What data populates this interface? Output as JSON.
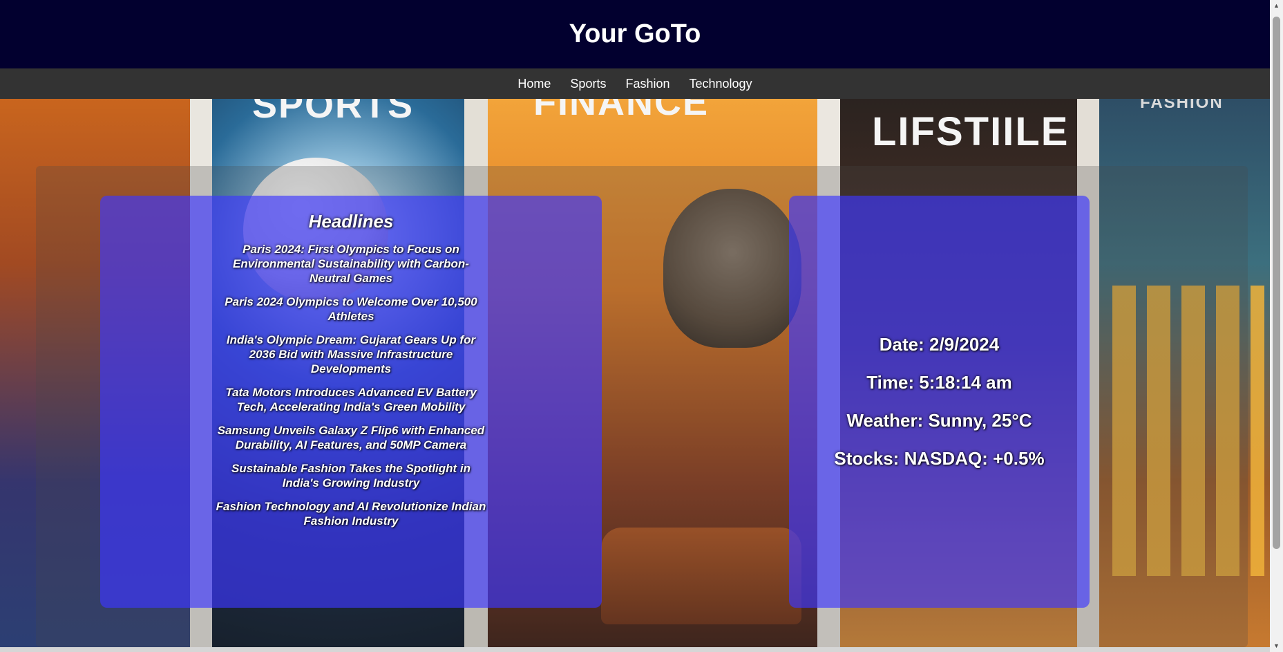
{
  "header": {
    "title": "Your GoTo"
  },
  "nav": {
    "items": [
      "Home",
      "Sports",
      "Fashion",
      "Technology"
    ]
  },
  "hero": {
    "background_words": [
      "SPORTS",
      "FINANCE",
      "LIFSTIILE",
      "FASHION"
    ]
  },
  "headlines": {
    "title": "Headlines",
    "items": [
      "Paris 2024: First Olympics to Focus on Environmental Sustainability with Carbon-Neutral Games",
      "Paris 2024 Olympics to Welcome Over 10,500 Athletes",
      "India's Olympic Dream: Gujarat Gears Up for 2036 Bid with Massive Infrastructure Developments",
      "Tata Motors Introduces Advanced EV Battery Tech, Accelerating India's Green Mobility",
      "Samsung Unveils Galaxy Z Flip6 with Enhanced Durability, AI Features, and 50MP Camera",
      "Sustainable Fashion Takes the Spotlight in India's Growing Industry",
      "Fashion Technology and AI Revolutionize Indian Fashion Industry"
    ]
  },
  "info": {
    "date": "Date: 2/9/2024",
    "time": "Time: 5:18:14 am",
    "weather": "Weather: Sunny, 25°C",
    "stocks": "Stocks: NASDAQ: +0.5%"
  },
  "colors": {
    "header_bg": "#02002f",
    "nav_bg": "#333333",
    "box_blue": "rgba(60,55,255,0.66)"
  },
  "icons": {
    "scroll_up": "triangle-up-icon",
    "scroll_down": "triangle-down-icon"
  }
}
